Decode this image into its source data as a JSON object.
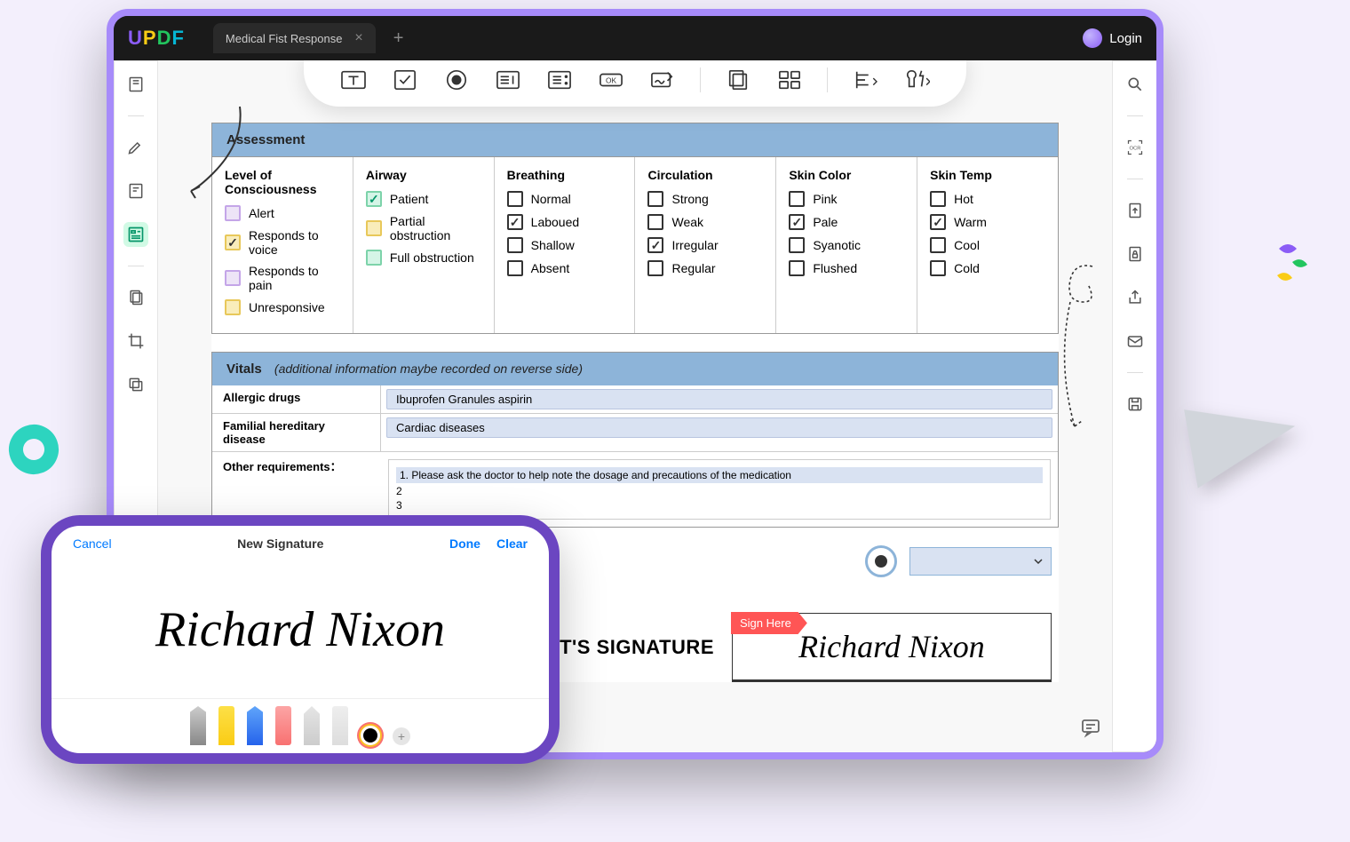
{
  "app": {
    "logo_letters": [
      "U",
      "P",
      "D",
      "F"
    ],
    "tab_title": "Medical Fist Response",
    "login_label": "Login"
  },
  "assessment": {
    "header": "Assessment",
    "columns": [
      {
        "title": "Level of Consciousness",
        "items": [
          {
            "label": "Alert",
            "style": "purple",
            "checked": false
          },
          {
            "label": "Responds to voice",
            "style": "yellow",
            "checked": true
          },
          {
            "label": "Responds to pain",
            "style": "purple",
            "checked": false
          },
          {
            "label": "Unresponsive",
            "style": "yellow",
            "checked": false
          }
        ]
      },
      {
        "title": "Airway",
        "items": [
          {
            "label": "Patient",
            "style": "green",
            "checked": true
          },
          {
            "label": "Partial obstruction",
            "style": "yellow",
            "checked": false
          },
          {
            "label": "Full obstruction",
            "style": "green",
            "checked": false
          }
        ]
      },
      {
        "title": "Breathing",
        "items": [
          {
            "label": "Normal",
            "style": "black",
            "checked": false
          },
          {
            "label": "Laboued",
            "style": "black",
            "checked": true
          },
          {
            "label": "Shallow",
            "style": "black",
            "checked": false
          },
          {
            "label": "Absent",
            "style": "black",
            "checked": false
          }
        ]
      },
      {
        "title": "Circulation",
        "items": [
          {
            "label": "Strong",
            "style": "black",
            "checked": false
          },
          {
            "label": "Weak",
            "style": "black",
            "checked": false
          },
          {
            "label": "Irregular",
            "style": "black",
            "checked": true
          },
          {
            "label": "Regular",
            "style": "black",
            "checked": false
          }
        ]
      },
      {
        "title": "Skin Color",
        "items": [
          {
            "label": "Pink",
            "style": "black",
            "checked": false
          },
          {
            "label": "Pale",
            "style": "black",
            "checked": true
          },
          {
            "label": "Syanotic",
            "style": "black",
            "checked": false
          },
          {
            "label": "Flushed",
            "style": "black",
            "checked": false
          }
        ]
      },
      {
        "title": "Skin Temp",
        "items": [
          {
            "label": "Hot",
            "style": "black",
            "checked": false
          },
          {
            "label": "Warm",
            "style": "black",
            "checked": true
          },
          {
            "label": "Cool",
            "style": "black",
            "checked": false
          },
          {
            "label": "Cold",
            "style": "black",
            "checked": false
          }
        ]
      }
    ]
  },
  "vitals": {
    "header": "Vitals",
    "note": "(additional information maybe recorded on reverse side)",
    "rows": [
      {
        "label": "Allergic drugs",
        "value": "Ibuprofen Granules  aspirin"
      },
      {
        "label": "Familial hereditary disease",
        "value": "Cardiac diseases"
      }
    ],
    "other_label": "Other requirements：",
    "other_lines": [
      "1. Please ask the doctor to help note the dosage and precautions of the medication",
      "2",
      "3"
    ]
  },
  "signature": {
    "label": "T'S SIGNATURE",
    "tag": "Sign Here",
    "name": "Richard Nixon"
  },
  "phone": {
    "cancel": "Cancel",
    "title": "New Signature",
    "done": "Done",
    "clear": "Clear",
    "signature_name": "Richard Nixon"
  }
}
